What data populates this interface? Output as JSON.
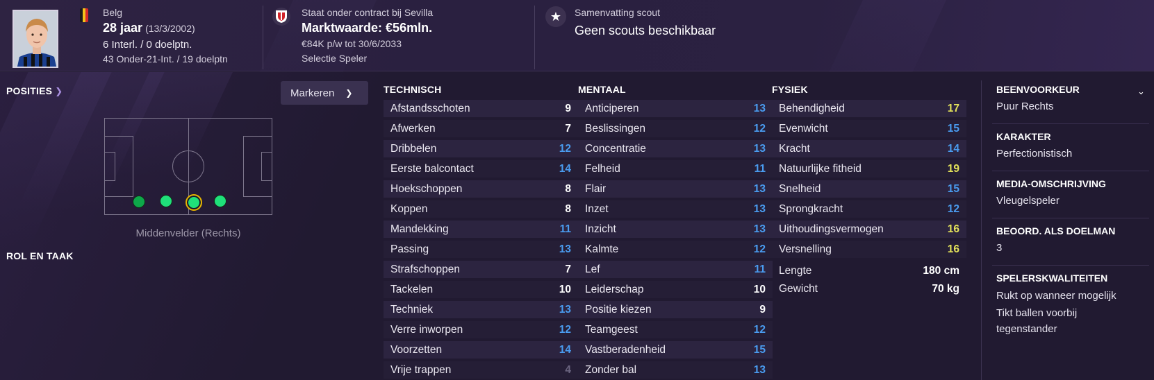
{
  "header": {
    "nationality": "Belg",
    "age": "28 jaar",
    "dob": "(13/3/2002)",
    "caps": "6 Interl. / 0 doelptn.",
    "u21_caps": "43 Onder-21-Int. / 19 doelptn",
    "contract_label": "Staat onder contract bij Sevilla",
    "market_value": "Marktwaarde: €56mln.",
    "wage": "€84K p/w tot 30/6/2033",
    "squad_status": "Selectie Speler",
    "scout_label": "Samenvatting scout",
    "scout_text": "Geen scouts beschikbaar",
    "flag_colors": [
      "#1a1a1a",
      "#f2c21b",
      "#d62a2a"
    ]
  },
  "positions": {
    "title": "POSITIES",
    "mark_button": "Markeren",
    "caption": "Middenvelder (Rechts)",
    "role_title": "ROL EN TAAK"
  },
  "technical": {
    "title": "TECHNISCH",
    "rows": [
      {
        "label": "Afstandsschoten",
        "value": "9",
        "color": "white"
      },
      {
        "label": "Afwerken",
        "value": "7",
        "color": "white"
      },
      {
        "label": "Dribbelen",
        "value": "12",
        "color": "blue"
      },
      {
        "label": "Eerste balcontact",
        "value": "14",
        "color": "blue"
      },
      {
        "label": "Hoekschoppen",
        "value": "8",
        "color": "white"
      },
      {
        "label": "Koppen",
        "value": "8",
        "color": "white"
      },
      {
        "label": "Mandekking",
        "value": "11",
        "color": "blue"
      },
      {
        "label": "Passing",
        "value": "13",
        "color": "blue"
      },
      {
        "label": "Strafschoppen",
        "value": "7",
        "color": "white"
      },
      {
        "label": "Tackelen",
        "value": "10",
        "color": "white"
      },
      {
        "label": "Techniek",
        "value": "13",
        "color": "blue"
      },
      {
        "label": "Verre inworpen",
        "value": "12",
        "color": "blue"
      },
      {
        "label": "Voorzetten",
        "value": "14",
        "color": "blue"
      },
      {
        "label": "Vrije trappen",
        "value": "4",
        "color": "grey"
      }
    ]
  },
  "mental": {
    "title": "MENTAAL",
    "rows": [
      {
        "label": "Anticiperen",
        "value": "13",
        "color": "blue"
      },
      {
        "label": "Beslissingen",
        "value": "12",
        "color": "blue"
      },
      {
        "label": "Concentratie",
        "value": "13",
        "color": "blue"
      },
      {
        "label": "Felheid",
        "value": "11",
        "color": "blue"
      },
      {
        "label": "Flair",
        "value": "13",
        "color": "blue"
      },
      {
        "label": "Inzet",
        "value": "13",
        "color": "blue"
      },
      {
        "label": "Inzicht",
        "value": "13",
        "color": "blue"
      },
      {
        "label": "Kalmte",
        "value": "12",
        "color": "blue"
      },
      {
        "label": "Lef",
        "value": "11",
        "color": "blue"
      },
      {
        "label": "Leiderschap",
        "value": "10",
        "color": "white"
      },
      {
        "label": "Positie kiezen",
        "value": "9",
        "color": "white"
      },
      {
        "label": "Teamgeest",
        "value": "12",
        "color": "blue"
      },
      {
        "label": "Vastberadenheid",
        "value": "15",
        "color": "blue"
      },
      {
        "label": "Zonder bal",
        "value": "13",
        "color": "blue"
      }
    ]
  },
  "physical": {
    "title": "FYSIEK",
    "rows": [
      {
        "label": "Behendigheid",
        "value": "17",
        "color": "yellow"
      },
      {
        "label": "Evenwicht",
        "value": "15",
        "color": "blue"
      },
      {
        "label": "Kracht",
        "value": "14",
        "color": "blue"
      },
      {
        "label": "Natuurlijke fitheid",
        "value": "19",
        "color": "yellow"
      },
      {
        "label": "Snelheid",
        "value": "15",
        "color": "blue"
      },
      {
        "label": "Sprongkracht",
        "value": "12",
        "color": "blue"
      },
      {
        "label": "Uithoudingsvermogen",
        "value": "16",
        "color": "yellow"
      },
      {
        "label": "Versnelling",
        "value": "16",
        "color": "yellow"
      }
    ],
    "height_label": "Lengte",
    "height_value": "180 cm",
    "weight_label": "Gewicht",
    "weight_value": "70 kg"
  },
  "sidebar": {
    "foot_title": "BEENVOORKEUR",
    "foot_value": "Puur Rechts",
    "personality_title": "KARAKTER",
    "personality_value": "Perfectionistisch",
    "media_title": "MEDIA-OMSCHRIJVING",
    "media_value": "Vleugelspeler",
    "gk_title": "BEOORD. ALS DOELMAN",
    "gk_value": "3",
    "traits_title": "SPELERSKWALITEITEN",
    "traits": [
      "Rukt op wanneer mogelijk",
      "Tikt ballen voorbij tegenstander"
    ]
  },
  "colors": {
    "white": "#ffffff",
    "blue": "#4a9cf0",
    "yellow": "#e4e35a",
    "grey": "#6b6580",
    "position_natural": "#1fe07a",
    "position_competent": "#0ea84a",
    "selected_ring": "#e8b400"
  }
}
